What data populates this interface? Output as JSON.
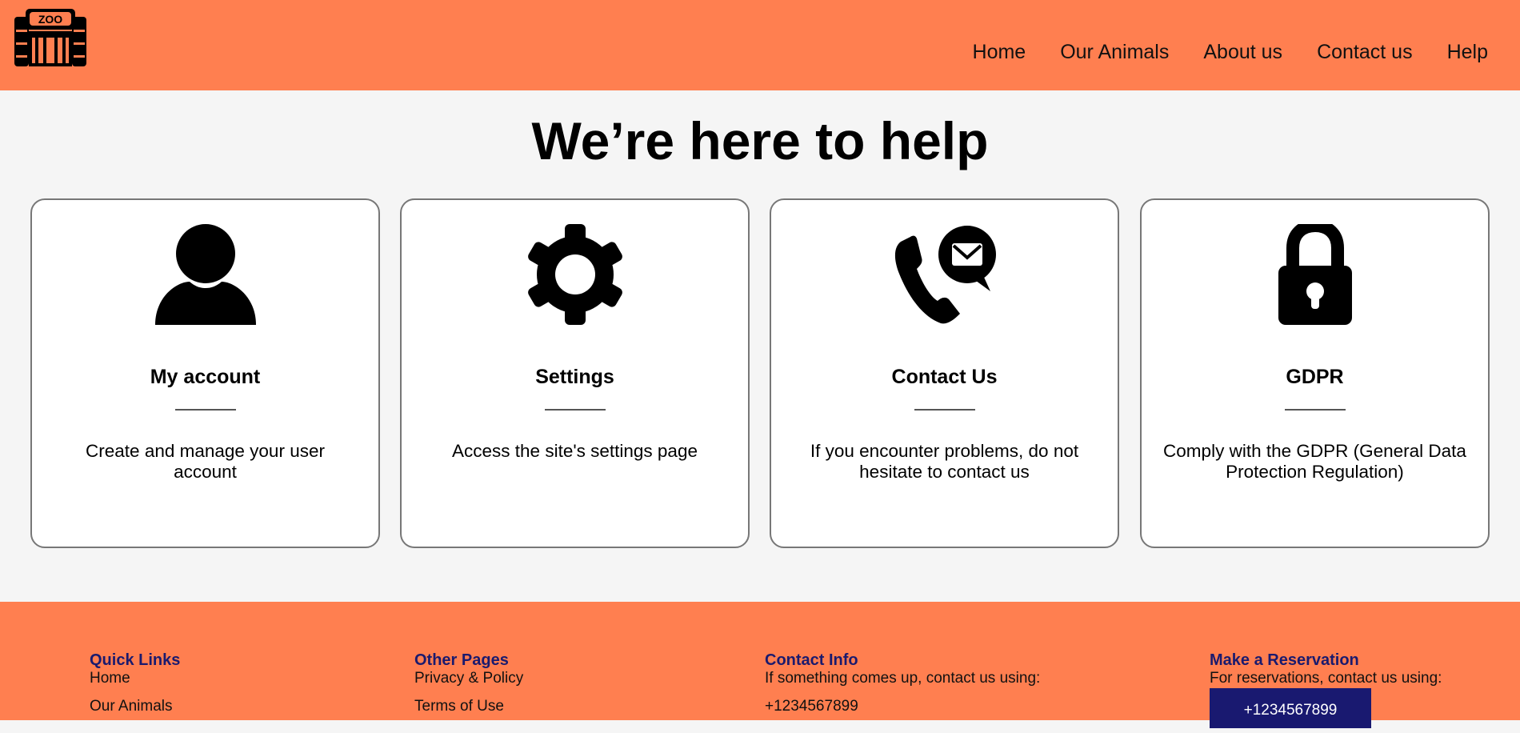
{
  "header": {
    "logo_text": "ZOO",
    "nav": [
      "Home",
      "Our Animals",
      "About us",
      "Contact us",
      "Help"
    ]
  },
  "page_title": "We’re here to help",
  "cards": [
    {
      "icon": "user-icon",
      "title": "My account",
      "description": "Create and manage your user account"
    },
    {
      "icon": "gear-icon",
      "title": "Settings",
      "description": "Access the site's settings page"
    },
    {
      "icon": "phone-mail-icon",
      "title": "Contact Us",
      "description": "If you encounter problems, do not hesitate to contact us"
    },
    {
      "icon": "lock-icon",
      "title": "GDPR",
      "description": "Comply with the GDPR (General Data Protection Regulation)"
    }
  ],
  "footer": {
    "quick_links": {
      "title": "Quick Links",
      "links": [
        "Home",
        "Our Animals"
      ]
    },
    "other_pages": {
      "title": "Other Pages",
      "links": [
        "Privacy & Policy",
        "Terms of Use"
      ]
    },
    "contact_info": {
      "title": "Contact Info",
      "text": "If something comes up, contact us using:",
      "phone": "+1234567899"
    },
    "reservation": {
      "title": "Make a Reservation",
      "text": "For reservations, contact us using:",
      "button": "+1234567899"
    }
  },
  "colors": {
    "header_bg": "#ff7f50",
    "footer_heading": "#1a1a6e",
    "button_bg": "#191970",
    "page_bg": "#f5f5f5"
  }
}
